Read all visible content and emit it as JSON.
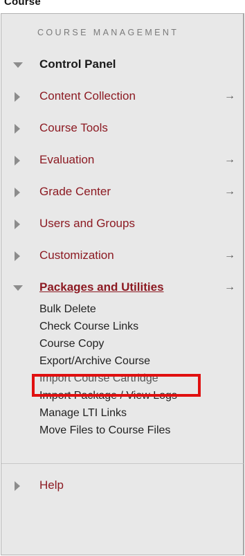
{
  "caption": "Course",
  "heading": "COURSE MANAGEMENT",
  "menu": [
    {
      "label": "Control Panel",
      "expanded": true,
      "style": "dark",
      "arrow": ""
    },
    {
      "label": "Content Collection",
      "expanded": false,
      "style": "link",
      "arrow": "→"
    },
    {
      "label": "Course Tools",
      "expanded": false,
      "style": "link",
      "arrow": ""
    },
    {
      "label": "Evaluation",
      "expanded": false,
      "style": "link",
      "arrow": "→"
    },
    {
      "label": "Grade Center",
      "expanded": false,
      "style": "link",
      "arrow": "→"
    },
    {
      "label": "Users and Groups",
      "expanded": false,
      "style": "link",
      "arrow": ""
    },
    {
      "label": "Customization",
      "expanded": false,
      "style": "link",
      "arrow": "→"
    },
    {
      "label": "Packages and Utilities",
      "expanded": true,
      "style": "packages",
      "arrow": "→"
    }
  ],
  "packages_items": [
    "Bulk Delete",
    "Check Course Links",
    "Course Copy",
    "Export/Archive Course",
    "Import Course Cartridge",
    "Import Package / View Logs",
    "Manage LTI Links",
    "Move Files to Course Files"
  ],
  "help": {
    "label": "Help"
  },
  "highlighted_item": "Export/Archive Course",
  "colors": {
    "link": "#8c1a22",
    "highlight": "#e01010",
    "panel_bg": "#e8e8e8"
  }
}
